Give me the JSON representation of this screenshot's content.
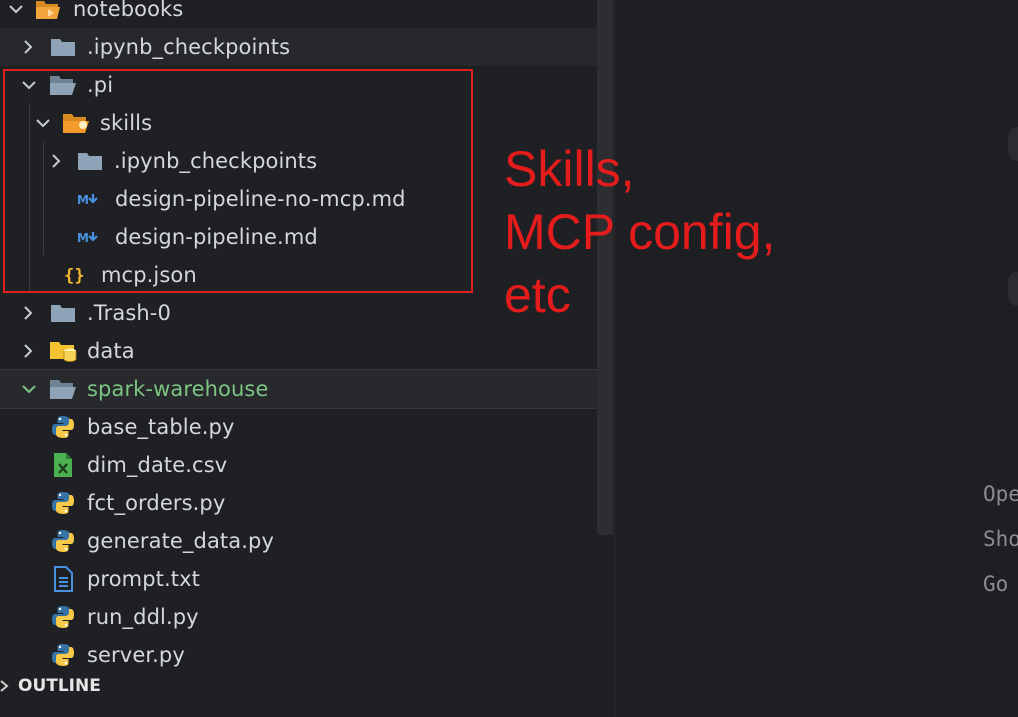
{
  "explorer": {
    "items": [
      {
        "label": "notebooks",
        "icon": "folder-open-notebooks-icon",
        "state": "expanded"
      },
      {
        "label": ".ipynb_checkpoints",
        "icon": "folder-icon",
        "state": "collapsed"
      },
      {
        "label": ".pi",
        "icon": "folder-open-icon",
        "state": "expanded"
      },
      {
        "label": "skills",
        "icon": "folder-open-skills-icon",
        "state": "expanded"
      },
      {
        "label": ".ipynb_checkpoints",
        "icon": "folder-icon",
        "state": "collapsed"
      },
      {
        "label": "design-pipeline-no-mcp.md",
        "icon": "markdown-icon"
      },
      {
        "label": "design-pipeline.md",
        "icon": "markdown-icon"
      },
      {
        "label": "mcp.json",
        "icon": "json-icon"
      },
      {
        "label": ".Trash-0",
        "icon": "folder-icon",
        "state": "collapsed"
      },
      {
        "label": "data",
        "icon": "folder-data-icon",
        "state": "collapsed"
      },
      {
        "label": "spark-warehouse",
        "icon": "folder-open-icon",
        "state": "expanded"
      },
      {
        "label": "base_table.py",
        "icon": "python-icon"
      },
      {
        "label": "dim_date.csv",
        "icon": "csv-icon"
      },
      {
        "label": "fct_orders.py",
        "icon": "python-icon"
      },
      {
        "label": "generate_data.py",
        "icon": "python-icon"
      },
      {
        "label": "prompt.txt",
        "icon": "text-file-icon"
      },
      {
        "label": "run_ddl.py",
        "icon": "python-icon"
      },
      {
        "label": "server.py",
        "icon": "python-icon"
      }
    ]
  },
  "outline": {
    "label": "OUTLINE"
  },
  "annotation": {
    "lines": [
      "Skills,",
      "MCP config,",
      "etc"
    ],
    "color": "#e51c1c"
  },
  "editor": {
    "menu": [
      "Ope",
      "Sho",
      "Go"
    ]
  },
  "colors": {
    "accent_green": "#7cc583",
    "folder": "#8fa3b8",
    "python_blue": "#3572a5",
    "python_yellow": "#f7c948"
  }
}
